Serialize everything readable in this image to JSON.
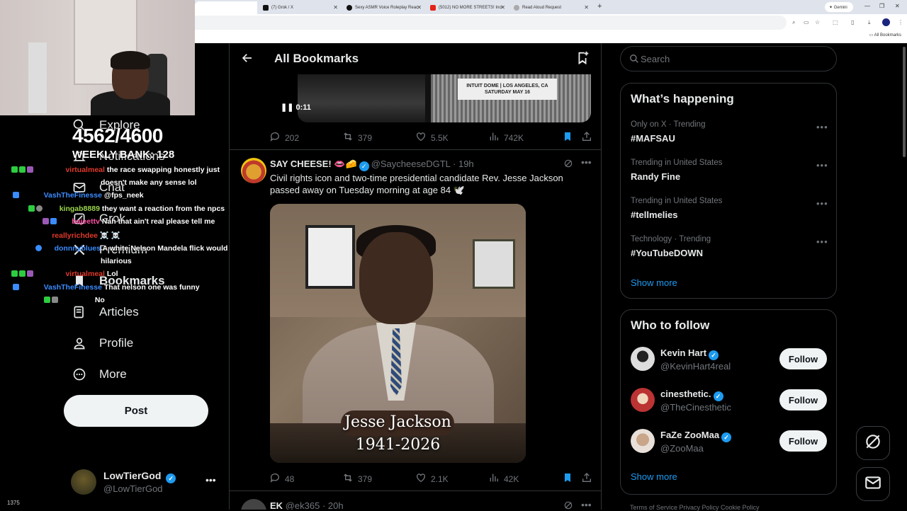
{
  "browser": {
    "tabs": [
      {
        "label": "(7) Grok / X",
        "color": "#111"
      },
      {
        "label": "Sexy ASMR Voice Roleplay Reac",
        "color": "#111"
      },
      {
        "label": "(5012) NO MORE STREETS! Incl",
        "color": "#e62117"
      },
      {
        "label": "Read Aloud Request",
        "color": "#888"
      }
    ],
    "gemini_label": "Gemini",
    "bookmarks_all": "All Bookmarks"
  },
  "overlay": {
    "counter": "4562/4600",
    "weekly": "WEEKLY BANK: 128",
    "chat": [
      {
        "name": "virtualmeal",
        "name_color": "#e0392b",
        "msg": "the race swapping honestly just",
        "msg2": "doesn't make any sense lol"
      },
      {
        "name": "VashTheFinesse",
        "name_color": "#3b8cff",
        "msg": "@fps_neek"
      },
      {
        "name": "kingab8889",
        "name_color": "#9bd44a",
        "msg": "they want a reaction from the npcs"
      },
      {
        "name": "bajeettv",
        "name_color": "#ff4fa3",
        "msg": "Nah that ain't real please tell me"
      },
      {
        "name": "reallyrichdee",
        "name_color": "#e0392b",
        "msg": "☠️ ☠️"
      },
      {
        "name": "donnnyblues",
        "name_color": "#3b8cff",
        "msg": "A white Nelson Mandela flick would be",
        "msg2": "hilarious"
      },
      {
        "name": "virtualmeal",
        "name_color": "#e0392b",
        "msg": "Lol"
      },
      {
        "name": "VashTheFinesse",
        "name_color": "#3b8cff",
        "msg": "That nelson one was funny"
      },
      {
        "name": "",
        "name_color": "#fff",
        "msg": "No"
      }
    ],
    "viewers": "1375"
  },
  "nav": {
    "explore": "Explore",
    "notifications": "Notifications",
    "chat": "Chat",
    "grok": "Grok",
    "premium": "Premium",
    "bookmarks": "Bookmarks",
    "articles": "Articles",
    "profile": "Profile",
    "more": "More",
    "post_button": "Post"
  },
  "account": {
    "name": "LowTierGod",
    "handle": "@LowTierGod"
  },
  "header": {
    "title": "All Bookmarks"
  },
  "video_post": {
    "ticket_text": "INTUIT DOME | LOS ANGELES, CA SATURDAY MAY 16",
    "time": "0:11",
    "replies": "202",
    "reposts": "379",
    "likes": "5.5K",
    "views": "742K"
  },
  "post": {
    "name": "SAY CHEESE! 👄🧀",
    "handle": "@SaycheeseDGTL",
    "time": "· 19h",
    "text": "Civil rights icon and two-time presidential candidate Rev. Jesse Jackson passed away on Tuesday morning at age 84 🕊️",
    "caption_name": "Jesse Jackson",
    "caption_years": "1941-2026",
    "replies": "48",
    "reposts": "379",
    "likes": "2.1K",
    "views": "42K"
  },
  "next_post": {
    "name": "EK",
    "handle": "@ek365",
    "time": "· 20h"
  },
  "search": {
    "placeholder": "Search"
  },
  "trends": {
    "title": "What’s happening",
    "items": [
      {
        "meta": "Only on X · Trending",
        "name": "#MAFSAU"
      },
      {
        "meta": "Trending in United States",
        "name": "Randy Fine"
      },
      {
        "meta": "Trending in United States",
        "name": "#tellmelies"
      },
      {
        "meta": "Technology · Trending",
        "name": "#YouTubeDOWN"
      }
    ],
    "show_more": "Show more"
  },
  "who_to_follow": {
    "title": "Who to follow",
    "items": [
      {
        "name": "Kevin Hart",
        "handle": "@KevinHart4real",
        "button": "Follow",
        "avatar_color": "#ddd"
      },
      {
        "name": "cinesthetic.",
        "handle": "@TheCinesthetic",
        "button": "Follow",
        "avatar_color": "#b33"
      },
      {
        "name": "FaZe ZooMaa",
        "handle": "@ZooMaa",
        "button": "Follow",
        "avatar_color": "#c9a58a"
      }
    ],
    "show_more": "Show more"
  },
  "footer": {
    "text": "Terms of Service  Privacy Policy  Cookie Policy"
  },
  "colors": {
    "accent": "#1d9bf0",
    "background": "#000000",
    "border": "#2f3336"
  }
}
